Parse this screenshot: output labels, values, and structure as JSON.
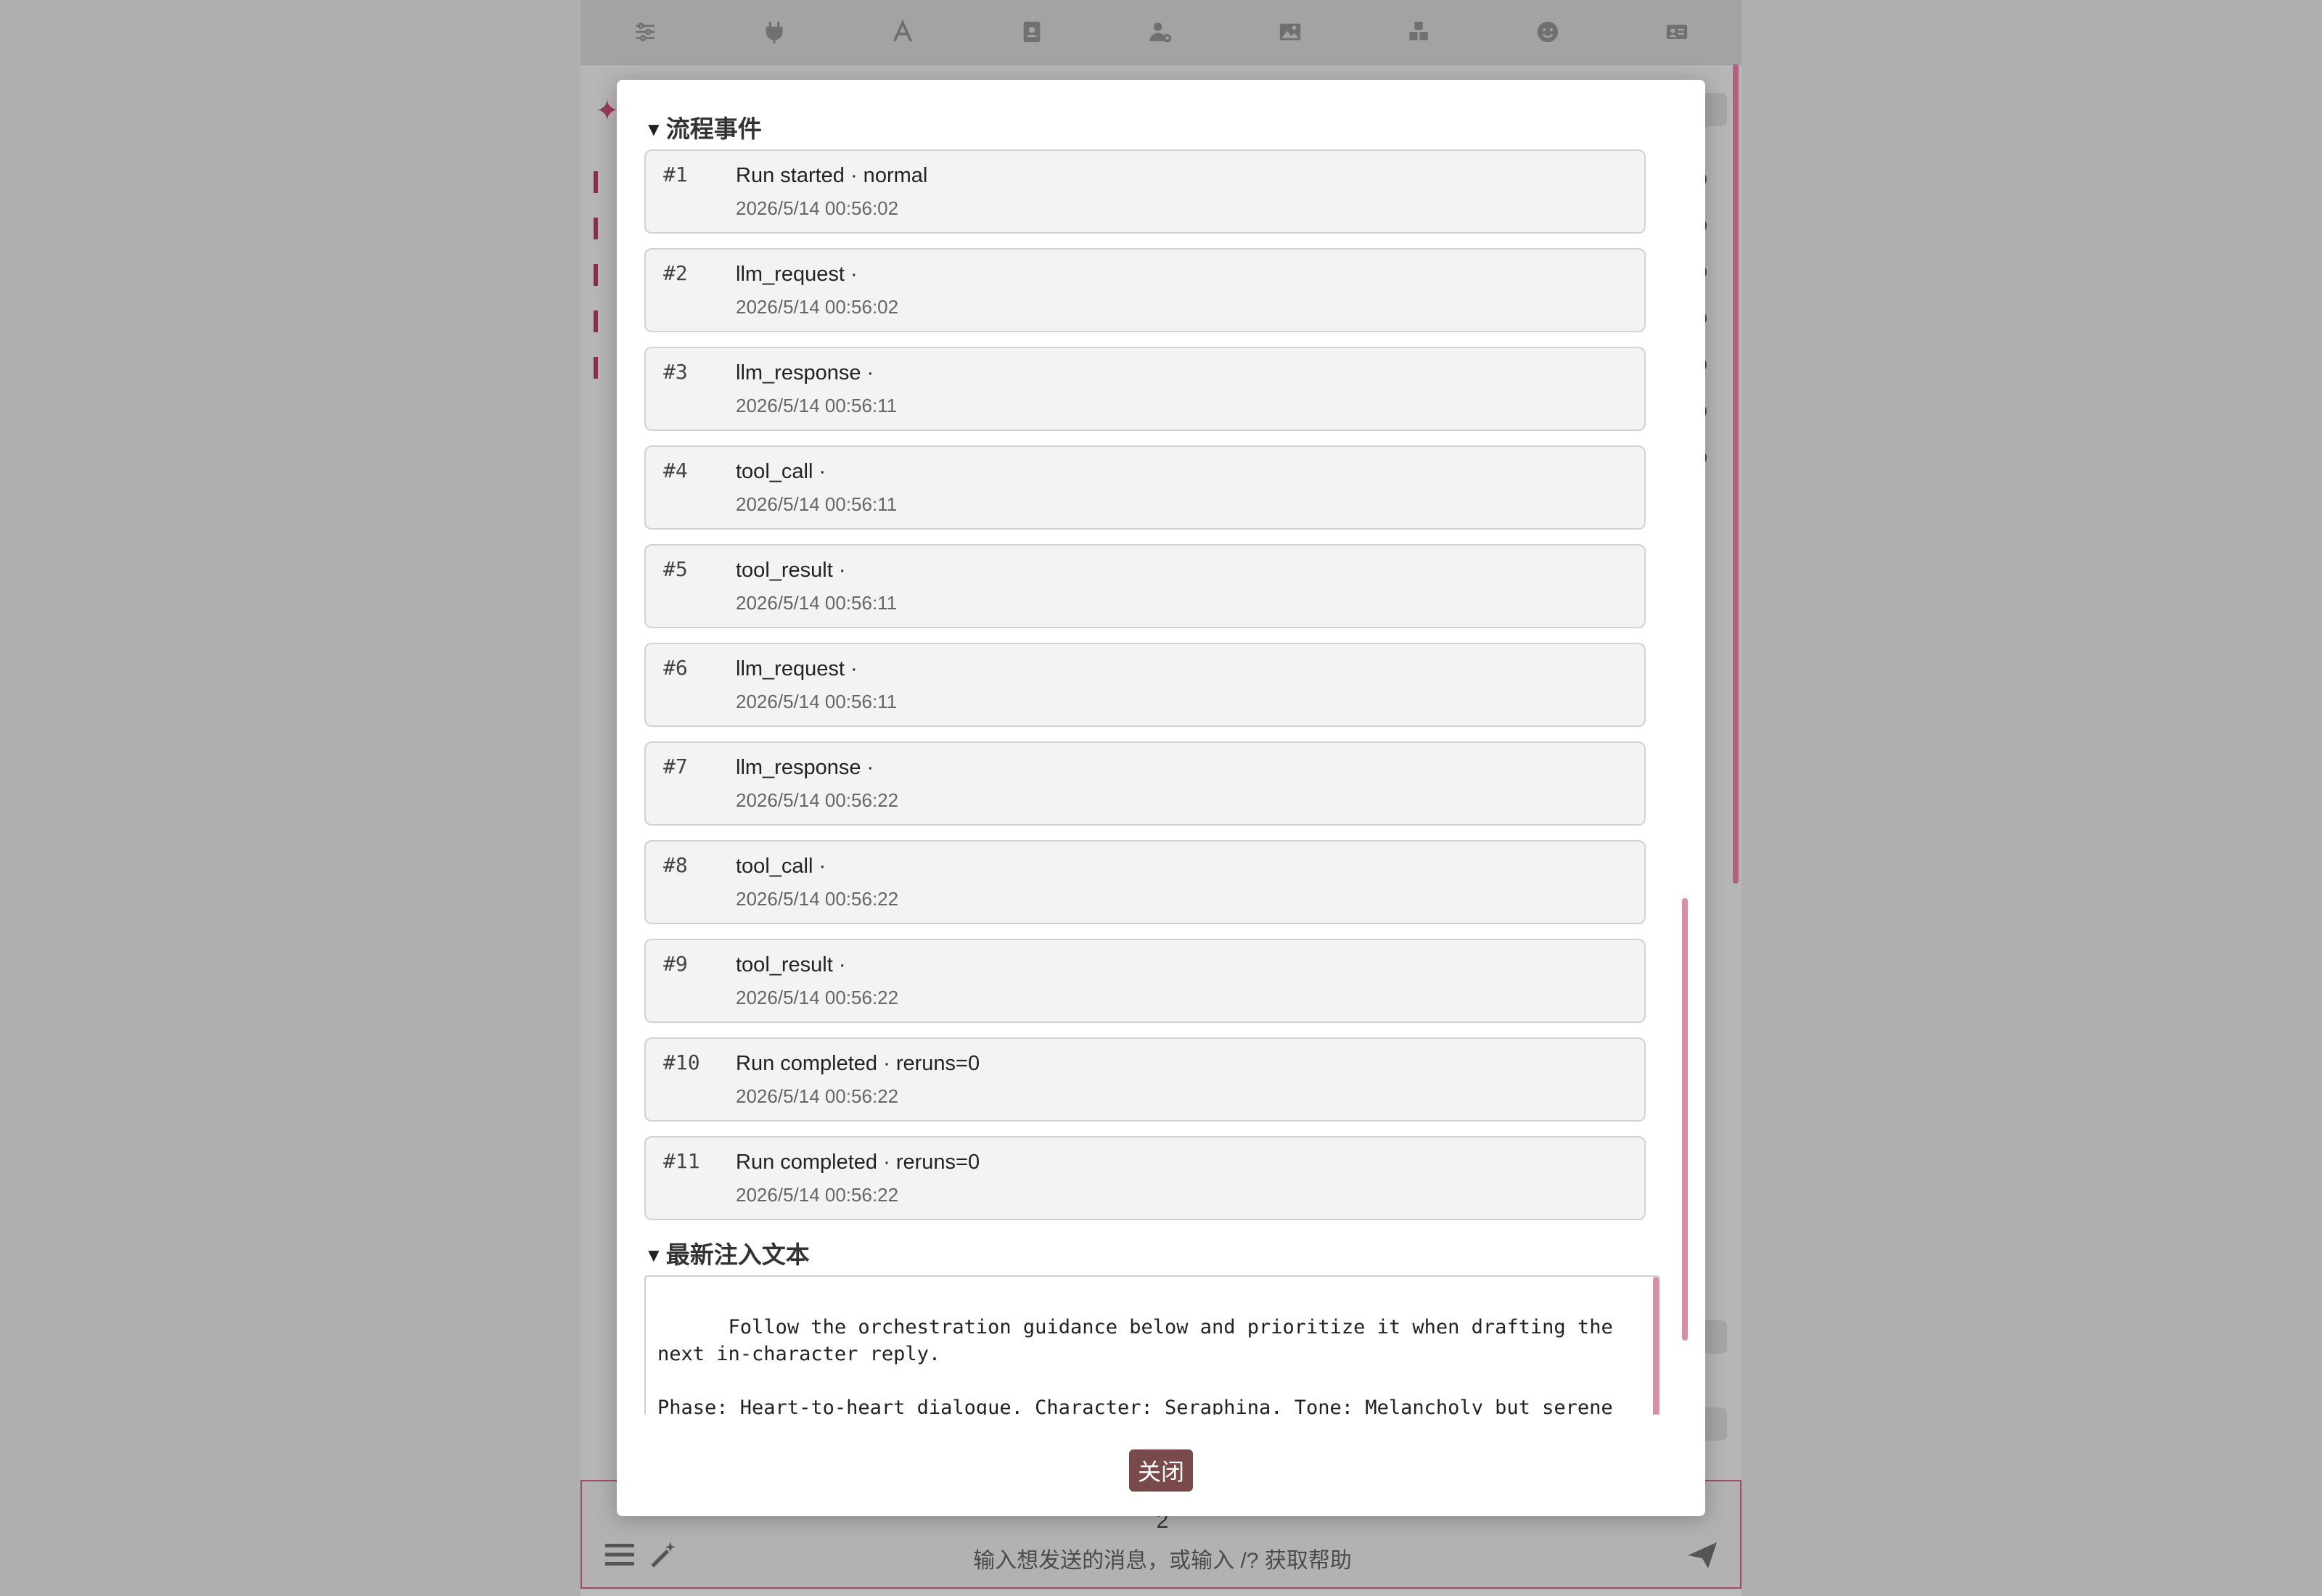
{
  "toolbar": {
    "icons": [
      "sliders-icon",
      "plug-icon",
      "font-icon",
      "address-book-icon",
      "user-gear-icon",
      "image-icon",
      "cubes-icon",
      "smile-icon",
      "id-card-icon"
    ]
  },
  "background": {
    "input_placeholder": "输入想发送的消息，或输入 /? 获取帮助",
    "counter": "2"
  },
  "modal": {
    "events_section_title": "流程事件",
    "events": [
      {
        "num": "#1",
        "title": "Run started · normal",
        "time": "2026/5/14 00:56:02"
      },
      {
        "num": "#2",
        "title": "llm_request ·",
        "time": "2026/5/14 00:56:02"
      },
      {
        "num": "#3",
        "title": "llm_response ·",
        "time": "2026/5/14 00:56:11"
      },
      {
        "num": "#4",
        "title": "tool_call ·",
        "time": "2026/5/14 00:56:11"
      },
      {
        "num": "#5",
        "title": "tool_result ·",
        "time": "2026/5/14 00:56:11"
      },
      {
        "num": "#6",
        "title": "llm_request ·",
        "time": "2026/5/14 00:56:11"
      },
      {
        "num": "#7",
        "title": "llm_response ·",
        "time": "2026/5/14 00:56:22"
      },
      {
        "num": "#8",
        "title": "tool_call ·",
        "time": "2026/5/14 00:56:22"
      },
      {
        "num": "#9",
        "title": "tool_result ·",
        "time": "2026/5/14 00:56:22"
      },
      {
        "num": "#10",
        "title": "Run completed · reruns=0",
        "time": "2026/5/14 00:56:22"
      },
      {
        "num": "#11",
        "title": "Run completed · reruns=0",
        "time": "2026/5/14 00:56:22"
      }
    ],
    "inject_section_title": "最新注入文本",
    "inject_text": "Follow the orchestration guidance below and prioritize it when drafting the next in-character reply.\n\nPhase: Heart-to-heart dialogue. Character: Seraphina. Tone: Melancholy but serene and nurturing.",
    "close_label": "关闭"
  }
}
